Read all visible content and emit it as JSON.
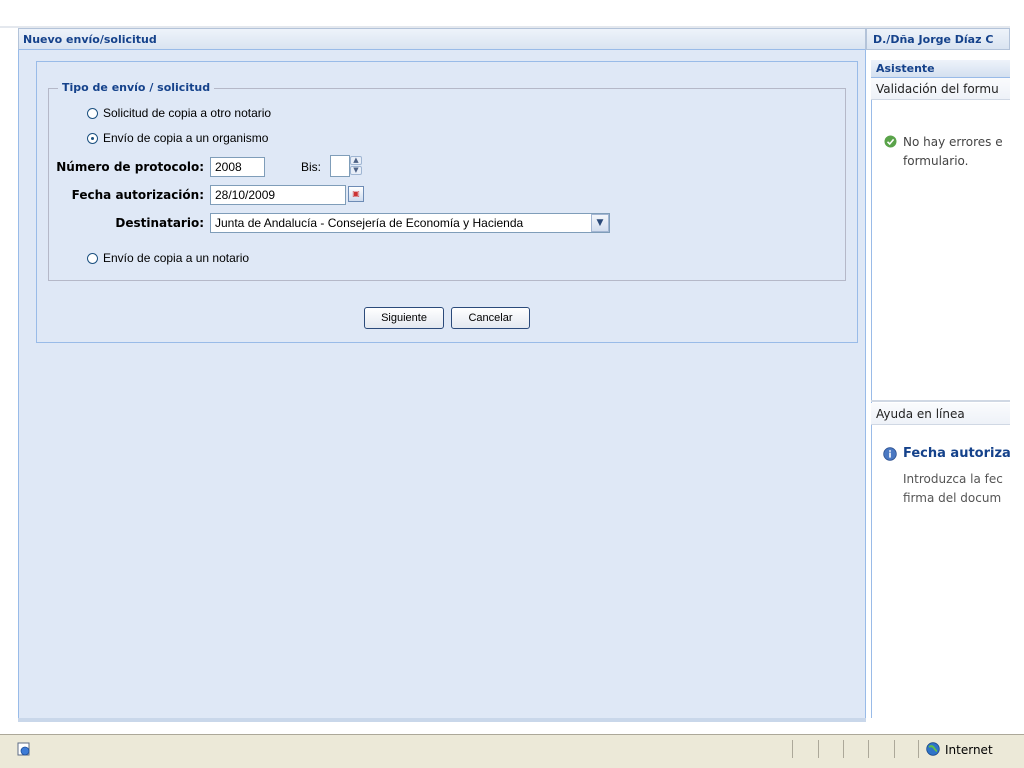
{
  "header": {
    "title": "Nuevo envío/solicitud",
    "user": "D./Dña Jorge Díaz C"
  },
  "form": {
    "legend": "Tipo de envío / solicitud",
    "radios": [
      {
        "label": "Solicitud de copia a otro notario",
        "checked": false
      },
      {
        "label": "Envío de copia a un organismo",
        "checked": true
      },
      {
        "label": "Envío de copia a un notario",
        "checked": false
      }
    ],
    "protocolo": {
      "label": "Número de protocolo:",
      "value": "2008"
    },
    "bis": {
      "label": "Bis:",
      "value": ""
    },
    "fecha": {
      "label": "Fecha autorización:",
      "value": "28/10/2009"
    },
    "destinatario": {
      "label": "Destinatario:",
      "value": "Junta de Andalucía - Consejería de Economía y Hacienda"
    },
    "buttons": {
      "next": "Siguiente",
      "cancel": "Cancelar"
    }
  },
  "side": {
    "panel_title": "Asistente",
    "validation": {
      "title": "Validación del formu",
      "message_line1": "No hay errores e",
      "message_line2": "formulario."
    },
    "help": {
      "title": "Ayuda en línea",
      "topic": "Fecha autoriza",
      "text_line1": "Introduzca la fec",
      "text_line2": "firma del docum"
    }
  },
  "statusbar": {
    "zone": "Internet"
  },
  "colors": {
    "panel_bg": "#dfe8f6",
    "header_text": "#15428b",
    "border": "#99bbe8"
  }
}
